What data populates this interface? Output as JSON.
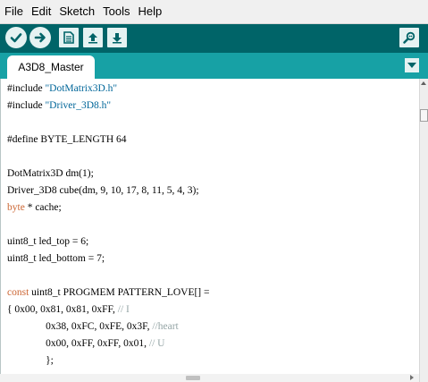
{
  "menu": [
    "File",
    "Edit",
    "Sketch",
    "Tools",
    "Help"
  ],
  "toolbar": {
    "buttons": [
      "verify-icon",
      "upload-icon",
      "new-icon",
      "open-icon",
      "save-icon"
    ],
    "right": "serial-monitor-icon"
  },
  "tabs": {
    "active": "A3D8_Master",
    "menu_icon": "tab-menu-chevron-icon"
  },
  "colors": {
    "toolbar": "#006468",
    "tabstrip": "#17a1a5",
    "string": "#006699",
    "keyword": "#cc6633",
    "comment": "#95a5a6"
  },
  "code": {
    "l1": {
      "a": "#include ",
      "b": "\"DotMatrix3D.h\""
    },
    "l2": {
      "a": "#include ",
      "b": "\"Driver_3D8.h\""
    },
    "l3": "#define BYTE_LENGTH 64",
    "l4": "DotMatrix3D dm(1);",
    "l5": "Driver_3D8 cube(dm, 9, 10, 17, 8, 11, 5, 4, 3);",
    "l6": {
      "a": "byte",
      "b": " * cache;"
    },
    "l7": "uint8_t led_top = 6;",
    "l8": "uint8_t led_bottom = 7;",
    "l9": {
      "a": "const",
      "b": " uint8_t PROGMEM PATTERN_LOVE[] ="
    },
    "l10": {
      "a": "{ 0x00, 0x81, 0x81, 0xFF, ",
      "b": "// I"
    },
    "l11": {
      "a": "               0x38, 0xFC, 0xFE, 0x3F, ",
      "b": "//heart"
    },
    "l12": {
      "a": "               0x00, 0xFF, 0xFF, 0x01, ",
      "b": "// U"
    },
    "l13": "               };"
  }
}
